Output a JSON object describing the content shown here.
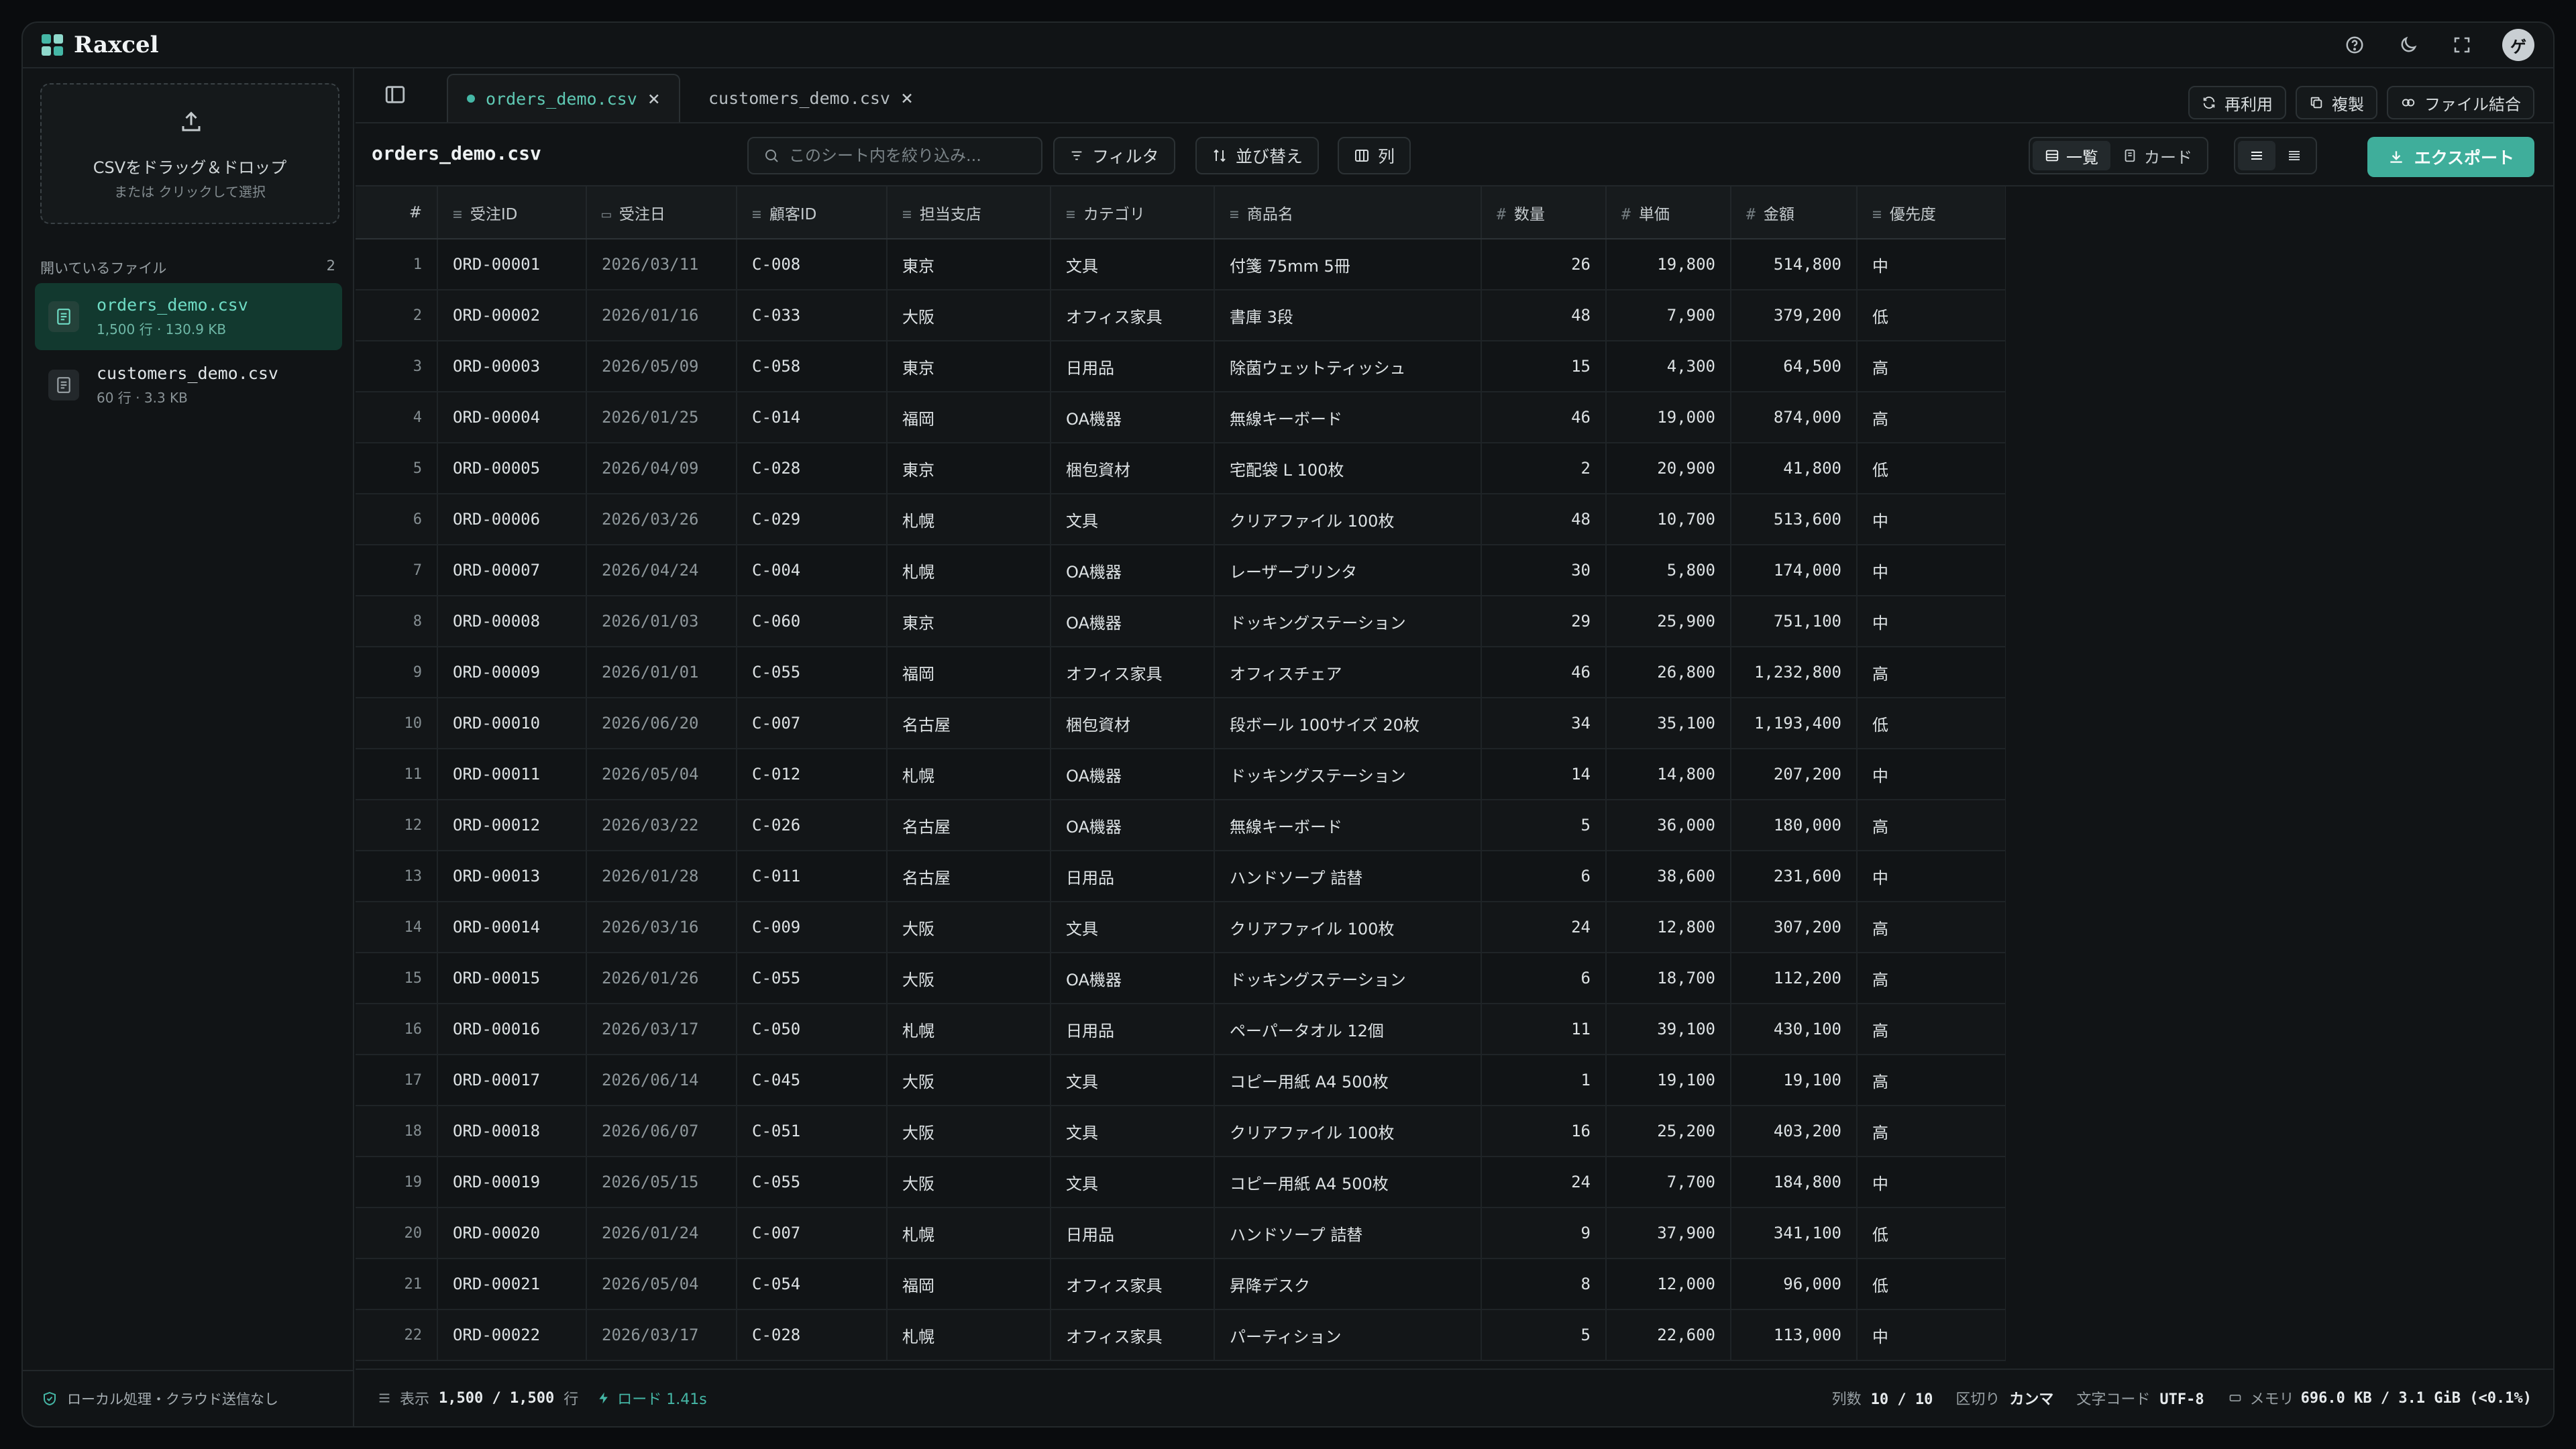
{
  "app": {
    "name": "Raxcel",
    "avatar_initial": "ゲ",
    "accent": "#45b7a6"
  },
  "titlebar": {
    "icons": [
      "help-icon",
      "moon-icon",
      "fullscreen-icon"
    ]
  },
  "sidebar": {
    "dropzone": {
      "title": "CSVをドラッグ＆ドロップ",
      "subtitle": "または クリックして選択"
    },
    "open_files_label": "開いているファイル",
    "open_files_count": "2",
    "files": [
      {
        "name": "orders_demo.csv",
        "meta": "1,500 行 · 130.9 KB",
        "active": true
      },
      {
        "name": "customers_demo.csv",
        "meta": "60 行 · 3.3 KB",
        "active": false
      }
    ],
    "footer": "ローカル処理・クラウド送信なし"
  },
  "tabs": [
    {
      "label": "orders_demo.csv",
      "active": true
    },
    {
      "label": "customers_demo.csv",
      "active": false
    }
  ],
  "tab_actions": {
    "reuse": "再利用",
    "duplicate": "複製",
    "merge": "ファイル結合"
  },
  "toolbar": {
    "sheet_title": "orders_demo.csv",
    "search_placeholder": "このシート内を絞り込み...",
    "filter": "フィルタ",
    "sort": "並び替え",
    "columns": "列",
    "view_list": "一覧",
    "view_card": "カード",
    "export": "エクスポート"
  },
  "table": {
    "columns": [
      {
        "label": "#",
        "icon": ""
      },
      {
        "label": "受注ID",
        "icon": "≡"
      },
      {
        "label": "受注日",
        "icon": "▭"
      },
      {
        "label": "顧客ID",
        "icon": "≡"
      },
      {
        "label": "担当支店",
        "icon": "≡"
      },
      {
        "label": "カテゴリ",
        "icon": "≡"
      },
      {
        "label": "商品名",
        "icon": "≡"
      },
      {
        "label": "数量",
        "icon": "#"
      },
      {
        "label": "単価",
        "icon": "#"
      },
      {
        "label": "金額",
        "icon": "#"
      },
      {
        "label": "優先度",
        "icon": "≡"
      }
    ],
    "rows": [
      [
        "1",
        "ORD-00001",
        "2026/03/11",
        "C-008",
        "東京",
        "文具",
        "付箋 75mm 5冊",
        "26",
        "19,800",
        "514,800",
        "中"
      ],
      [
        "2",
        "ORD-00002",
        "2026/01/16",
        "C-033",
        "大阪",
        "オフィス家具",
        "書庫 3段",
        "48",
        "7,900",
        "379,200",
        "低"
      ],
      [
        "3",
        "ORD-00003",
        "2026/05/09",
        "C-058",
        "東京",
        "日用品",
        "除菌ウェットティッシュ",
        "15",
        "4,300",
        "64,500",
        "高"
      ],
      [
        "4",
        "ORD-00004",
        "2026/01/25",
        "C-014",
        "福岡",
        "OA機器",
        "無線キーボード",
        "46",
        "19,000",
        "874,000",
        "高"
      ],
      [
        "5",
        "ORD-00005",
        "2026/04/09",
        "C-028",
        "東京",
        "梱包資材",
        "宅配袋 L 100枚",
        "2",
        "20,900",
        "41,800",
        "低"
      ],
      [
        "6",
        "ORD-00006",
        "2026/03/26",
        "C-029",
        "札幌",
        "文具",
        "クリアファイル 100枚",
        "48",
        "10,700",
        "513,600",
        "中"
      ],
      [
        "7",
        "ORD-00007",
        "2026/04/24",
        "C-004",
        "札幌",
        "OA機器",
        "レーザープリンタ",
        "30",
        "5,800",
        "174,000",
        "中"
      ],
      [
        "8",
        "ORD-00008",
        "2026/01/03",
        "C-060",
        "東京",
        "OA機器",
        "ドッキングステーション",
        "29",
        "25,900",
        "751,100",
        "中"
      ],
      [
        "9",
        "ORD-00009",
        "2026/01/01",
        "C-055",
        "福岡",
        "オフィス家具",
        "オフィスチェア",
        "46",
        "26,800",
        "1,232,800",
        "高"
      ],
      [
        "10",
        "ORD-00010",
        "2026/06/20",
        "C-007",
        "名古屋",
        "梱包資材",
        "段ボール 100サイズ 20枚",
        "34",
        "35,100",
        "1,193,400",
        "低"
      ],
      [
        "11",
        "ORD-00011",
        "2026/05/04",
        "C-012",
        "札幌",
        "OA機器",
        "ドッキングステーション",
        "14",
        "14,800",
        "207,200",
        "中"
      ],
      [
        "12",
        "ORD-00012",
        "2026/03/22",
        "C-026",
        "名古屋",
        "OA機器",
        "無線キーボード",
        "5",
        "36,000",
        "180,000",
        "高"
      ],
      [
        "13",
        "ORD-00013",
        "2026/01/28",
        "C-011",
        "名古屋",
        "日用品",
        "ハンドソープ 詰替",
        "6",
        "38,600",
        "231,600",
        "中"
      ],
      [
        "14",
        "ORD-00014",
        "2026/03/16",
        "C-009",
        "大阪",
        "文具",
        "クリアファイル 100枚",
        "24",
        "12,800",
        "307,200",
        "高"
      ],
      [
        "15",
        "ORD-00015",
        "2026/01/26",
        "C-055",
        "大阪",
        "OA機器",
        "ドッキングステーション",
        "6",
        "18,700",
        "112,200",
        "高"
      ],
      [
        "16",
        "ORD-00016",
        "2026/03/17",
        "C-050",
        "札幌",
        "日用品",
        "ペーパータオル 12個",
        "11",
        "39,100",
        "430,100",
        "高"
      ],
      [
        "17",
        "ORD-00017",
        "2026/06/14",
        "C-045",
        "大阪",
        "文具",
        "コピー用紙 A4 500枚",
        "1",
        "19,100",
        "19,100",
        "高"
      ],
      [
        "18",
        "ORD-00018",
        "2026/06/07",
        "C-051",
        "大阪",
        "文具",
        "クリアファイル 100枚",
        "16",
        "25,200",
        "403,200",
        "高"
      ],
      [
        "19",
        "ORD-00019",
        "2026/05/15",
        "C-055",
        "大阪",
        "文具",
        "コピー用紙 A4 500枚",
        "24",
        "7,700",
        "184,800",
        "中"
      ],
      [
        "20",
        "ORD-00020",
        "2026/01/24",
        "C-007",
        "札幌",
        "日用品",
        "ハンドソープ 詰替",
        "9",
        "37,900",
        "341,100",
        "低"
      ],
      [
        "21",
        "ORD-00021",
        "2026/05/04",
        "C-054",
        "福岡",
        "オフィス家具",
        "昇降デスク",
        "8",
        "12,000",
        "96,000",
        "低"
      ],
      [
        "22",
        "ORD-00022",
        "2026/03/17",
        "C-028",
        "札幌",
        "オフィス家具",
        "パーティション",
        "5",
        "22,600",
        "113,000",
        "中"
      ]
    ]
  },
  "status": {
    "display_label": "表示",
    "display_value": "1,500 / 1,500",
    "rows_unit": "行",
    "load": "ロード 1.41s",
    "cols_label": "列数",
    "cols_value": "10 / 10",
    "delim_label": "区切り",
    "delim_value": "カンマ",
    "enc_label": "文字コード",
    "enc_value": "UTF-8",
    "mem_label": "メモリ",
    "mem_value": "696.0 KB / 3.1 GiB (<0.1%)"
  }
}
